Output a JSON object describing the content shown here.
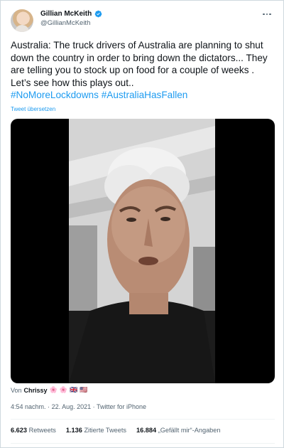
{
  "author": {
    "display_name": "Gillian McKeith",
    "handle": "@GillianMcKeith",
    "verified_icon": "verified-badge-icon"
  },
  "more_icon": "more-dots-icon",
  "tweet": {
    "text": "Australia: The truck drivers of Australia are planning to shut down the country in order to bring down the dictators...  They are telling you to stock up on food for a couple of weeks .  Let’s see how this plays out..",
    "hashtags": [
      "#NoMoreLockdowns",
      "#AustraliaHasFallen"
    ],
    "translate_label": "Tweet übersetzen"
  },
  "media": {
    "byline_prefix": "Von",
    "byline_name": "Chrissy",
    "byline_emojis": [
      "🌸",
      "🌸",
      "🇬🇧",
      "🇺🇸"
    ]
  },
  "meta": {
    "time": "4:54 nachm.",
    "date": "22. Aug. 2021",
    "source": "Twitter for iPhone",
    "separator": "·"
  },
  "stats": [
    {
      "count": "6.623",
      "label": "Retweets"
    },
    {
      "count": "1.136",
      "label": "Zitierte Tweets"
    },
    {
      "count": "16.884",
      "label": "„Gefällt mir“-Angaben"
    }
  ],
  "colors": {
    "accent": "#1d9bf0",
    "text": "#0f1419",
    "secondary": "#536471"
  }
}
